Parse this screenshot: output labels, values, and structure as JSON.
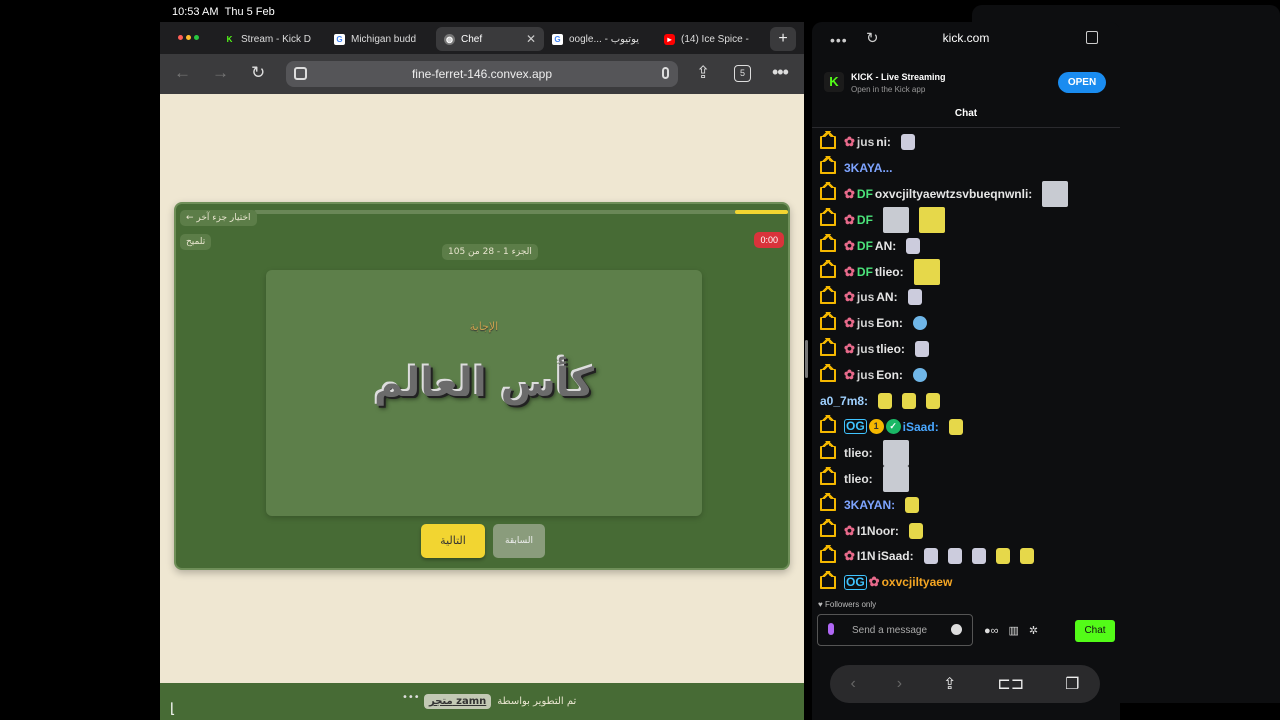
{
  "status": {
    "time": "10:53 AM",
    "date": "Thu 5 Feb"
  },
  "left_browser": {
    "tabs": [
      {
        "label": "Stream - Kick D",
        "icon": "kick-icon"
      },
      {
        "label": "Michigan budd",
        "icon": "google-icon"
      },
      {
        "label": "Chef",
        "icon": "chef-icon",
        "active": true
      },
      {
        "label": "oogle... - يوتيوب",
        "icon": "google-icon"
      },
      {
        "label": "(14) Ice Spice -",
        "icon": "youtube-icon"
      }
    ],
    "url": "fine-ferret-146.convex.app",
    "tab_count": "5"
  },
  "game": {
    "back_label": "← اختيار جزء آخر",
    "hint_label": "تلميح",
    "timer": "0:00",
    "part_label": "الجزء 1 - 28 من 105",
    "category": "الإجابة",
    "word": "كأس العالم",
    "next_label": "التالية",
    "prev_label": "السابقة",
    "progress": 0.1
  },
  "footer": {
    "text": "تم التطوير بواسطة",
    "store": "متجر zamn"
  },
  "right_browser": {
    "url": "kick.com",
    "app_name": "KICK - Live Streaming",
    "app_sub": "Open in the Kick app",
    "open_label": "OPEN",
    "chat_title": "Chat",
    "followers_only": "Followers only",
    "placeholder": "Send a message",
    "chat_button": "Chat"
  },
  "chat_messages": [
    {
      "user": "jus",
      "color": "#cfcfcf",
      "badges": "crown-flower",
      "text": "ni:"
    },
    {
      "user": "3KAYA...",
      "color": "#7ea4ff",
      "badges": "crown",
      "text": ""
    },
    {
      "user": "DF",
      "color": "#4be37a",
      "badges": "crown-flower",
      "text": "oxvcjiltyaewtzsvbueqnwnli:"
    },
    {
      "user": "DF",
      "color": "#4be37a",
      "badges": "crown-flower",
      "text": ""
    },
    {
      "user": "DF",
      "color": "#4be37a",
      "badges": "crown-flower",
      "text": "AN:"
    },
    {
      "user": "DF",
      "color": "#4be37a",
      "badges": "crown-flower",
      "text": "tlieo:"
    },
    {
      "user": "jus",
      "color": "#cfcfcf",
      "badges": "crown-flower",
      "text": "AN:"
    },
    {
      "user": "jus",
      "color": "#cfcfcf",
      "badges": "crown-flower",
      "text": "Eon:"
    },
    {
      "user": "jus",
      "color": "#cfcfcf",
      "badges": "crown-flower",
      "text": "tlieo:"
    },
    {
      "user": "jus",
      "color": "#cfcfcf",
      "badges": "crown-flower",
      "text": "Eon:"
    },
    {
      "user": "a0_7m8:",
      "color": "#9fd1ff",
      "badges": "",
      "text": ""
    },
    {
      "user": "iSaad:",
      "color": "#49a7ff",
      "badges": "crown-og-1-check",
      "text": ""
    },
    {
      "user": "tlieo:",
      "color": "#e0e0e0",
      "badges": "crown",
      "text": ""
    },
    {
      "user": "tlieo:",
      "color": "#e0e0e0",
      "badges": "crown",
      "text": ""
    },
    {
      "user": "3KAYAN:",
      "color": "#7ea4ff",
      "badges": "crown",
      "text": ""
    },
    {
      "user": "I1Noor:",
      "color": "#e0e0e0",
      "badges": "crown-flower",
      "text": ""
    },
    {
      "user": "I1N",
      "color": "#e0e0e0",
      "badges": "crown-flower",
      "text": "iSaad:"
    },
    {
      "user": "oxvcjiltyaew",
      "color": "#f5a623",
      "badges": "crown-og-flower",
      "text": ""
    }
  ]
}
